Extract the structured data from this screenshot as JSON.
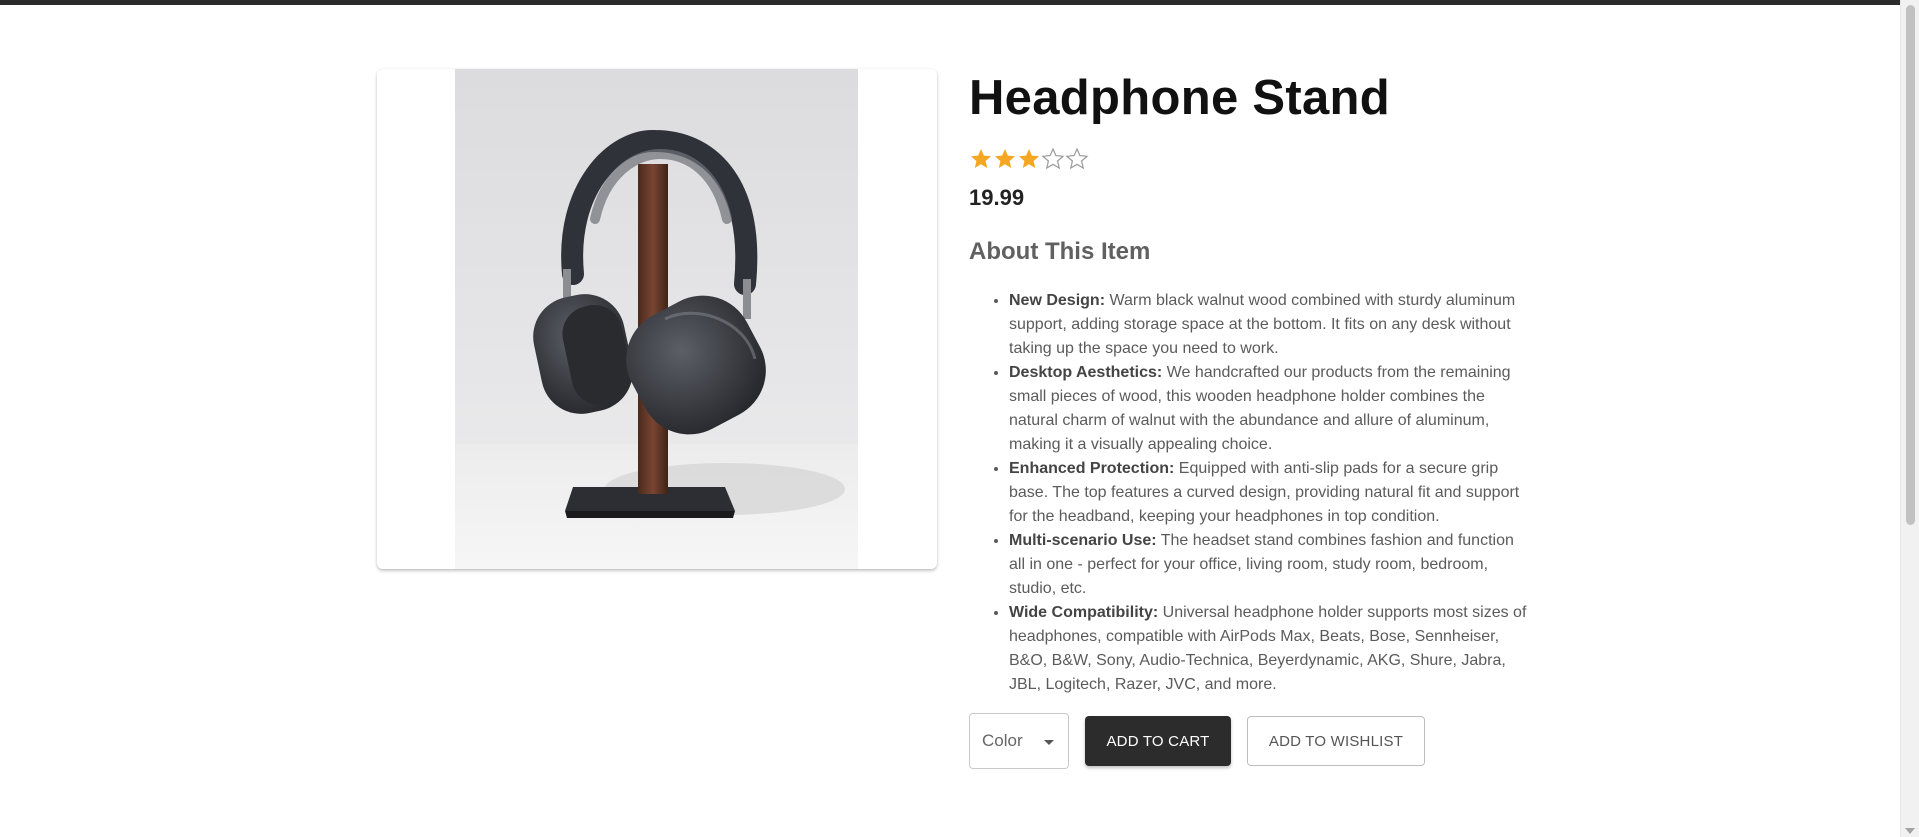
{
  "product": {
    "title": "Headphone Stand",
    "rating": 3,
    "rating_max": 5,
    "price": "19.99",
    "image_alt": "headphone-stand-photo",
    "about_heading": "About This Item",
    "features": [
      {
        "label": "New Design:",
        "text": " Warm black walnut wood combined with sturdy aluminum support, adding storage space at the bottom. It fits on any desk without taking up the space you need to work."
      },
      {
        "label": "Desktop Aesthetics:",
        "text": " We handcrafted our products from the remaining small pieces of wood, this wooden headphone holder combines the natural charm of walnut with the abundance and allure of aluminum, making it a visually appealing choice."
      },
      {
        "label": "Enhanced Protection:",
        "text": " Equipped with anti-slip pads for a secure grip base. The top features a curved design, providing natural fit and support for the headband, keeping your headphones in top condition."
      },
      {
        "label": "Multi-scenario Use:",
        "text": " The headset stand combines fashion and function all in one - perfect for your office, living room, study room, bedroom, studio, etc."
      },
      {
        "label": "Wide Compatibility:",
        "text": " Universal headphone holder supports most sizes of headphones, compatible with AirPods Max, Beats, Bose, Sennheiser, B&O, B&W, Sony, Audio-Technica, Beyerdynamic, AKG, Shure, Jabra, JBL, Logitech, Razer, JVC, and more."
      }
    ]
  },
  "actions": {
    "color_select_value": "Color",
    "add_to_cart_label": "ADD TO CART",
    "add_to_wishlist_label": "ADD TO WISHLIST"
  },
  "colors": {
    "star_filled": "#f5a623",
    "star_empty": "#9a9a9a",
    "primary_button": "#2c2c2c",
    "top_bar": "#2b2b2b"
  }
}
